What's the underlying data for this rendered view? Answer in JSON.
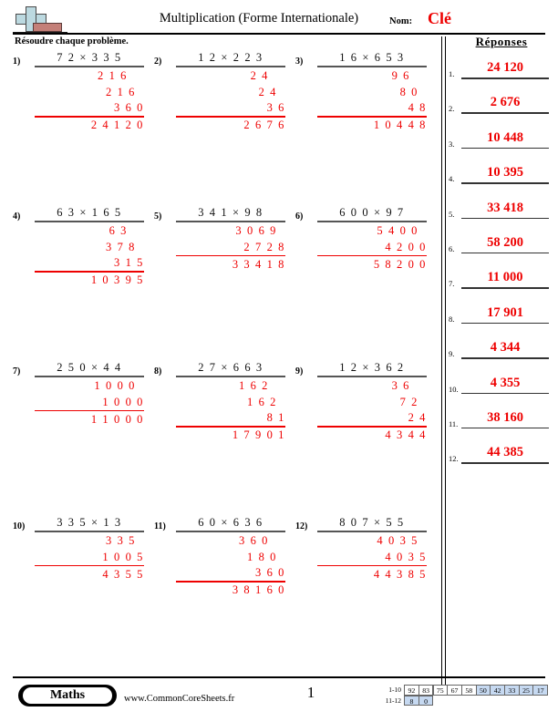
{
  "header": {
    "logo_name": "commoncoresheets-logo",
    "title": "Multiplication (Forme Internationale)",
    "name_label": "Nom:",
    "name_value": "Clé",
    "name_color": "#ee0000"
  },
  "subhead": {
    "instruction": "Résoudre chaque problème.",
    "answers_title": "Réponses"
  },
  "problems": [
    {
      "number": "1)",
      "expression": "7 2 × 3 3 5",
      "partials": [
        "2 1 6",
        "2 1 6",
        "3 6 0"
      ],
      "total": "2 4 1 2 0"
    },
    {
      "number": "2)",
      "expression": "1 2 × 2 2 3",
      "partials": [
        "2 4",
        "2 4",
        "3 6"
      ],
      "total": "2 6 7 6"
    },
    {
      "number": "3)",
      "expression": "1 6 × 6 5 3",
      "partials": [
        "9 6",
        "8 0",
        "4 8"
      ],
      "total": "1 0 4 4 8"
    },
    {
      "number": "4)",
      "expression": "6 3 × 1 6 5",
      "partials": [
        "6 3",
        "3 7 8",
        "3 1 5"
      ],
      "total": "1 0 3 9 5"
    },
    {
      "number": "5)",
      "expression": "3 4 1 × 9 8",
      "partials": [
        "3 0 6 9",
        "2 7 2 8"
      ],
      "total": "3 3 4 1 8"
    },
    {
      "number": "6)",
      "expression": "6 0 0 × 9 7",
      "partials": [
        "5 4 0 0",
        "4 2 0 0"
      ],
      "total": "5 8 2 0 0"
    },
    {
      "number": "7)",
      "expression": "2 5 0 × 4 4",
      "partials": [
        "1 0 0 0",
        "1 0 0 0"
      ],
      "total": "1 1 0 0 0"
    },
    {
      "number": "8)",
      "expression": "2 7 × 6 6 3",
      "partials": [
        "1 6 2",
        "1 6 2",
        "8 1"
      ],
      "total": "1 7 9 0 1"
    },
    {
      "number": "9)",
      "expression": "1 2 × 3 6 2",
      "partials": [
        "3 6",
        "7 2",
        "2 4"
      ],
      "total": "4 3 4 4"
    },
    {
      "number": "10)",
      "expression": "3 3 5 × 1 3",
      "partials": [
        "3 3 5",
        "1 0 0 5"
      ],
      "total": "4 3 5 5"
    },
    {
      "number": "11)",
      "expression": "6 0 × 6 3 6",
      "partials": [
        "3 6 0",
        "1 8 0",
        "3 6 0"
      ],
      "total": "3 8 1 6 0"
    },
    {
      "number": "12)",
      "expression": "8 0 7 × 5 5",
      "partials": [
        "4 0 3 5",
        "4 0 3 5"
      ],
      "total": "4 4 3 8 5"
    }
  ],
  "answers": [
    {
      "number": "1.",
      "value": "24 120"
    },
    {
      "number": "2.",
      "value": "2 676"
    },
    {
      "number": "3.",
      "value": "10 448"
    },
    {
      "number": "4.",
      "value": "10 395"
    },
    {
      "number": "5.",
      "value": "33 418"
    },
    {
      "number": "6.",
      "value": "58 200"
    },
    {
      "number": "7.",
      "value": "11 000"
    },
    {
      "number": "8.",
      "value": "17 901"
    },
    {
      "number": "9.",
      "value": "4 344"
    },
    {
      "number": "10.",
      "value": "4 355"
    },
    {
      "number": "11.",
      "value": "38 160"
    },
    {
      "number": "12.",
      "value": "44 385"
    }
  ],
  "footer": {
    "subject_label": "Maths",
    "site_url": "www.CommonCoreSheets.fr",
    "page_number": "1",
    "score_table": {
      "rows": [
        {
          "range": "1-10",
          "cells": [
            {
              "value": "92",
              "highlighted": false
            },
            {
              "value": "83",
              "highlighted": false
            },
            {
              "value": "75",
              "highlighted": false
            },
            {
              "value": "67",
              "highlighted": false
            },
            {
              "value": "58",
              "highlighted": false
            },
            {
              "value": "50",
              "highlighted": true
            },
            {
              "value": "42",
              "highlighted": true
            },
            {
              "value": "33",
              "highlighted": true
            },
            {
              "value": "25",
              "highlighted": true
            },
            {
              "value": "17",
              "highlighted": true
            }
          ]
        },
        {
          "range": "11-12",
          "cells": [
            {
              "value": "8",
              "highlighted": true
            },
            {
              "value": "0",
              "highlighted": true
            }
          ]
        }
      ],
      "highlight_color": "#c6d9f1"
    }
  }
}
